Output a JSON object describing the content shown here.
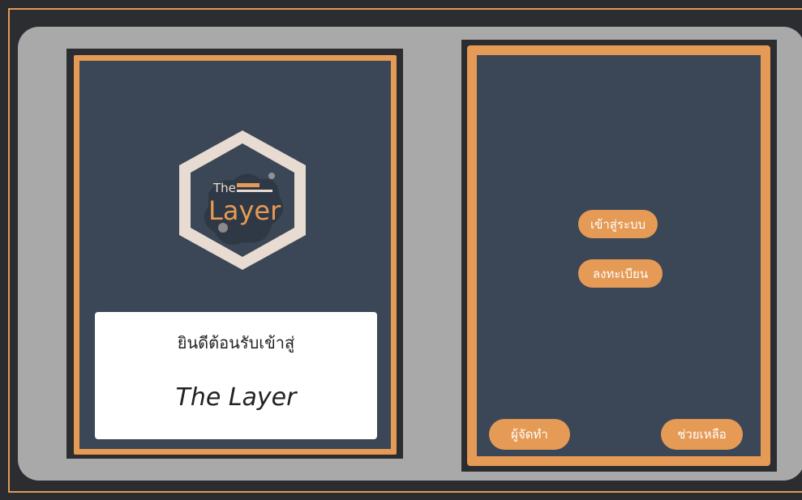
{
  "welcome": {
    "greeting": "ยินดีต้อนรับเข้าสู่",
    "brand": "The Layer"
  },
  "logo": {
    "top_text": "The",
    "main_text": "Layer"
  },
  "menu": {
    "login_label": "เข้าสู่ระบบ",
    "register_label": "ลงทะเบียน",
    "creators_label": "ผู้จัดทำ",
    "help_label": "ช่วยเหลือ"
  },
  "colors": {
    "accent": "#e59a55",
    "panel": "#3b4756",
    "background": "#a9a9a9",
    "logo_paper": "#e8dcd2"
  }
}
